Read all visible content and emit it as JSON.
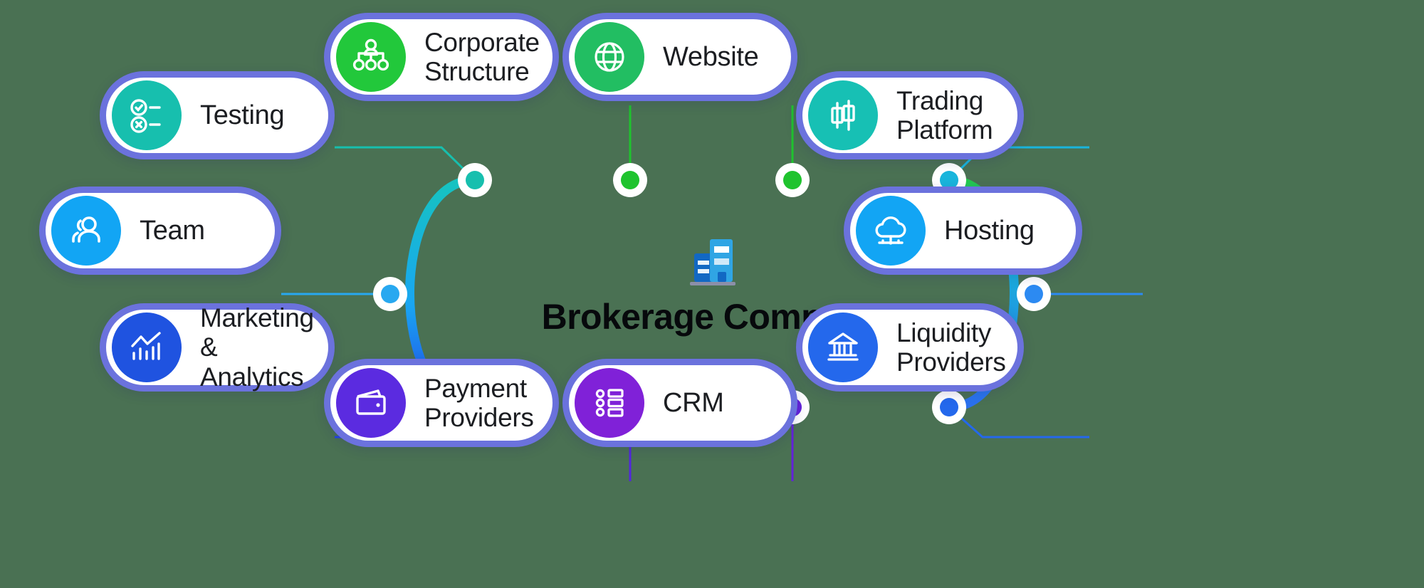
{
  "center": {
    "title": "Brokerage Company",
    "icon": "office-building-icon",
    "icon_colors": {
      "dark": "#1268C3",
      "light": "#30A5E4",
      "base": "#8C8FA8"
    }
  },
  "diagram": {
    "card_border_color": "#6B72DD",
    "card_background": "#FFFFFF",
    "background": "#4A7153",
    "ring_gradient": [
      "#16C3C0",
      "#2BC93F",
      "#1DA5EC",
      "#2244E8",
      "#7B27D6"
    ]
  },
  "nodes": [
    {
      "id": "testing",
      "label": "Testing",
      "icon": "test-check-cross-icon",
      "color": "#17BFAE"
    },
    {
      "id": "team",
      "label": "Team",
      "icon": "people-group-icon",
      "color": "#12A5F4"
    },
    {
      "id": "marketing",
      "label": "Marketing\n& Analytics",
      "icon": "analytics-chart-icon",
      "color": "#1F53E0"
    },
    {
      "id": "corporate",
      "label": "Corporate\nStructure",
      "icon": "org-chart-icon",
      "color": "#22C83B"
    },
    {
      "id": "website",
      "label": "Website",
      "icon": "globe-icon",
      "color": "#22BE62"
    },
    {
      "id": "payment",
      "label": "Payment\nProviders",
      "icon": "wallet-icon",
      "color": "#5B2BE0"
    },
    {
      "id": "crm",
      "label": "CRM",
      "icon": "list-checklist-icon",
      "color": "#8021D8"
    },
    {
      "id": "trading",
      "label": "Trading\nPlatform",
      "icon": "candlestick-icon",
      "color": "#17C0B4"
    },
    {
      "id": "hosting",
      "label": "Hosting",
      "icon": "cloud-server-icon",
      "color": "#12A5F4"
    },
    {
      "id": "liquidity",
      "label": "Liquidity\nProviders",
      "icon": "bank-columns-icon",
      "color": "#2468EC"
    }
  ],
  "connector_dots": [
    {
      "id": "dot-testing",
      "color": "#17BFAE"
    },
    {
      "id": "dot-corporate",
      "color": "#1FC32E"
    },
    {
      "id": "dot-website",
      "color": "#1FC32E"
    },
    {
      "id": "dot-trading",
      "color": "#19B5DC"
    },
    {
      "id": "dot-team",
      "color": "#28A8F0"
    },
    {
      "id": "dot-hosting",
      "color": "#2C8AF2"
    },
    {
      "id": "dot-marketing",
      "color": "#2244E8"
    },
    {
      "id": "dot-payment",
      "color": "#5227DE"
    },
    {
      "id": "dot-crm",
      "color": "#6322DA"
    },
    {
      "id": "dot-liquidity",
      "color": "#2468EC"
    }
  ]
}
